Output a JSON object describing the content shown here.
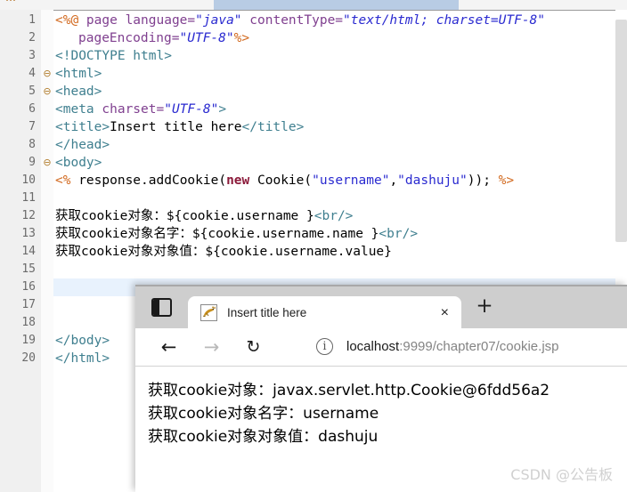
{
  "editor": {
    "app": "eclipse-jsp-editor",
    "filename_tabs_cutoff": true,
    "current_line": 16,
    "gutter_bg": "#f0f0f0",
    "current_line_highlight": "#e8f2fd",
    "lines": [
      {
        "n": 1,
        "fold": "",
        "indent": false,
        "tokens": [
          {
            "t": "<%@ ",
            "c": "t-dir"
          },
          {
            "t": "page ",
            "c": "t-attr"
          },
          {
            "t": "language=",
            "c": "t-attr"
          },
          {
            "t": "\"java\"",
            "c": "t-val"
          },
          {
            "t": " ",
            "c": "t-txt"
          },
          {
            "t": "contentType=",
            "c": "t-attr"
          },
          {
            "t": "\"text/html; charset=UTF-8\"",
            "c": "t-val"
          }
        ]
      },
      {
        "n": 2,
        "fold": "",
        "indent": true,
        "tokens": [
          {
            "t": "pageEncoding=",
            "c": "t-attr"
          },
          {
            "t": "\"UTF-8\"",
            "c": "t-val"
          },
          {
            "t": "%>",
            "c": "t-dir"
          }
        ]
      },
      {
        "n": 3,
        "fold": "",
        "indent": false,
        "tokens": [
          {
            "t": "<!DOCTYPE html>",
            "c": "t-tag"
          }
        ]
      },
      {
        "n": 4,
        "fold": "⊖",
        "indent": false,
        "tokens": [
          {
            "t": "<html>",
            "c": "t-tag"
          }
        ]
      },
      {
        "n": 5,
        "fold": "⊖",
        "indent": false,
        "tokens": [
          {
            "t": "<head>",
            "c": "t-tag"
          }
        ]
      },
      {
        "n": 6,
        "fold": "",
        "indent": false,
        "tokens": [
          {
            "t": "<meta ",
            "c": "t-tag"
          },
          {
            "t": "charset=",
            "c": "t-attr"
          },
          {
            "t": "\"UTF-8\"",
            "c": "t-val"
          },
          {
            "t": ">",
            "c": "t-tag"
          }
        ]
      },
      {
        "n": 7,
        "fold": "",
        "indent": false,
        "tokens": [
          {
            "t": "<title>",
            "c": "t-tag"
          },
          {
            "t": "Insert title here",
            "c": "t-txt"
          },
          {
            "t": "</title>",
            "c": "t-tag"
          }
        ]
      },
      {
        "n": 8,
        "fold": "",
        "indent": false,
        "tokens": [
          {
            "t": "</head>",
            "c": "t-tag"
          }
        ]
      },
      {
        "n": 9,
        "fold": "⊖",
        "indent": false,
        "tokens": [
          {
            "t": "<body>",
            "c": "t-tag"
          }
        ]
      },
      {
        "n": 10,
        "fold": "",
        "indent": false,
        "tokens": [
          {
            "t": "<% ",
            "c": "t-dir"
          },
          {
            "t": "response.addCookie(",
            "c": "t-txt"
          },
          {
            "t": "new",
            "c": "t-kw"
          },
          {
            "t": " Cookie(",
            "c": "t-txt"
          },
          {
            "t": "\"username\"",
            "c": "t-str"
          },
          {
            "t": ",",
            "c": "t-txt"
          },
          {
            "t": "\"dashuju\"",
            "c": "t-str"
          },
          {
            "t": ")); ",
            "c": "t-txt"
          },
          {
            "t": "%>",
            "c": "t-dir"
          }
        ]
      },
      {
        "n": 11,
        "fold": "",
        "indent": false,
        "tokens": []
      },
      {
        "n": 12,
        "fold": "",
        "indent": false,
        "tokens": [
          {
            "t": "获取cookie对象：${cookie.username }",
            "c": "t-txt"
          },
          {
            "t": "<br/>",
            "c": "t-tag"
          }
        ]
      },
      {
        "n": 13,
        "fold": "",
        "indent": false,
        "tokens": [
          {
            "t": "获取cookie对象名字：${cookie.username.name }",
            "c": "t-txt"
          },
          {
            "t": "<br/>",
            "c": "t-tag"
          }
        ]
      },
      {
        "n": 14,
        "fold": "",
        "indent": false,
        "tokens": [
          {
            "t": "获取cookie对象对象值：${cookie.username.value}",
            "c": "t-txt"
          }
        ]
      },
      {
        "n": 15,
        "fold": "",
        "indent": false,
        "tokens": []
      },
      {
        "n": 16,
        "fold": "",
        "indent": false,
        "tokens": []
      },
      {
        "n": 17,
        "fold": "",
        "indent": false,
        "tokens": []
      },
      {
        "n": 18,
        "fold": "",
        "indent": false,
        "tokens": []
      },
      {
        "n": 19,
        "fold": "",
        "indent": false,
        "tokens": [
          {
            "t": "</body>",
            "c": "t-tag"
          }
        ]
      },
      {
        "n": 20,
        "fold": "",
        "indent": false,
        "tokens": [
          {
            "t": "</html>",
            "c": "t-tag"
          }
        ]
      }
    ]
  },
  "browser": {
    "collections_icon": "collections-icon",
    "tab": {
      "favicon": "tomcat-cat-favicon",
      "title": "Insert title here",
      "close_label": "×"
    },
    "new_tab_label": "+",
    "nav": {
      "back_label": "←",
      "forward_label": "→",
      "reload_label": "↻"
    },
    "omnibox": {
      "info_label": "i",
      "url_host": "localhost",
      "url_rest": ":9999/chapter07/cookie.jsp"
    },
    "page": {
      "lines": [
        "获取cookie对象：javax.servlet.http.Cookie@6fdd56a2",
        "获取cookie对象名字：username",
        "获取cookie对象对象值：dashuju"
      ],
      "watermark": "CSDN @公告板"
    }
  }
}
